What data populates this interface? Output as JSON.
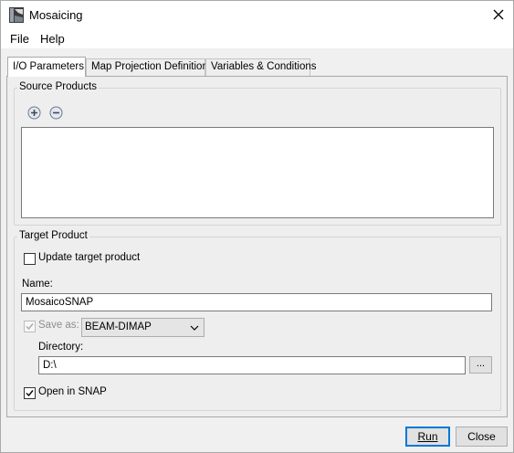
{
  "window": {
    "title": "Mosaicing",
    "icons": {
      "app": "snap-app-icon",
      "close": "close-icon"
    }
  },
  "menu": {
    "items": [
      "File",
      "Help"
    ]
  },
  "tabs": [
    {
      "label": "I/O Parameters",
      "active": true
    },
    {
      "label": "Map Projection Definition",
      "active": false
    },
    {
      "label": "Variables & Conditions",
      "active": false
    }
  ],
  "source_products": {
    "legend": "Source Products",
    "add_icon": "plus-circle-icon",
    "remove_icon": "minus-circle-icon",
    "items": []
  },
  "target_product": {
    "legend": "Target Product",
    "update_target": {
      "label": "Update target product",
      "checked": false
    },
    "name_label": "Name:",
    "name_value": "MosaicoSNAP",
    "save_as": {
      "label": "Save as:",
      "checked": true,
      "enabled": false
    },
    "format": "BEAM-DIMAP",
    "directory_label": "Directory:",
    "directory_value": "D:\\",
    "browse_label": "...",
    "open_in_snap": {
      "label": "Open in SNAP",
      "checked": true
    }
  },
  "buttons": {
    "run_label": "Run",
    "close_label": "Close"
  },
  "colors": {
    "default_button_border": "#0078d7",
    "panel_bg": "#eeeeee",
    "icon_gray": "#6d7a8c"
  }
}
